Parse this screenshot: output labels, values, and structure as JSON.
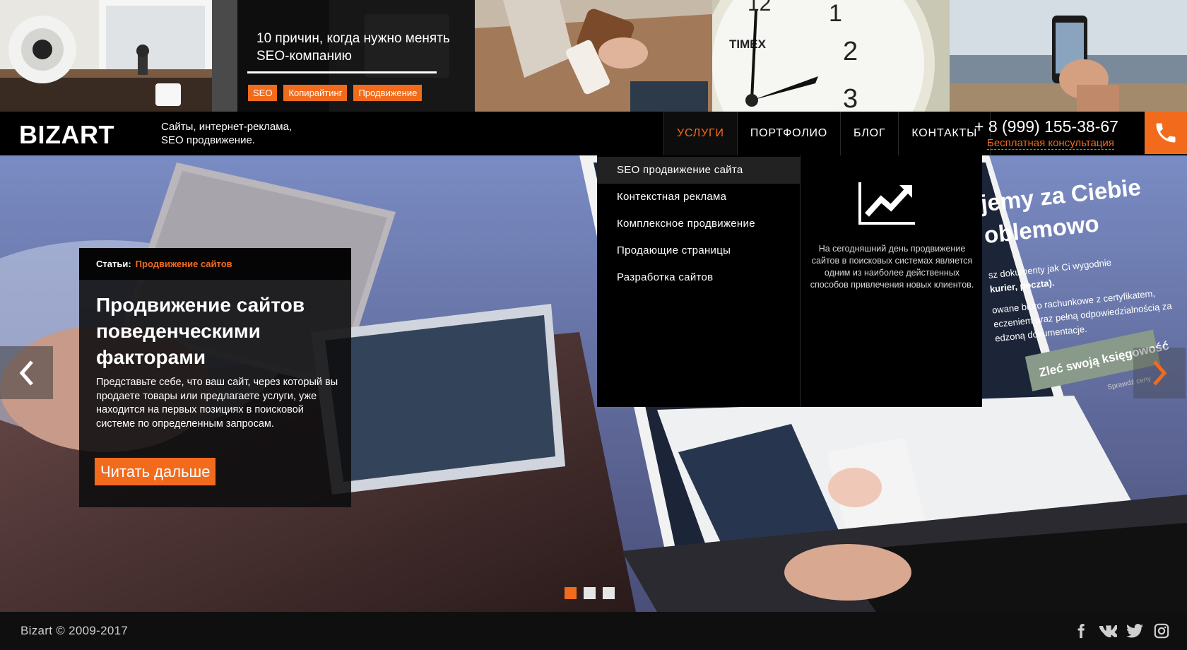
{
  "featured": {
    "title": "10 причин, когда нужно менять SEO-компанию",
    "tags": [
      "SEO",
      "Копирайтинг",
      "Продвижение"
    ]
  },
  "clock": {
    "brand": "TIMEX",
    "numbers": [
      "12",
      "1",
      "2",
      "3"
    ]
  },
  "header": {
    "logo": "BIZART",
    "tagline": "Сайты, интернет-реклама, SEO продвижение.",
    "nav": [
      "УСЛУГИ",
      "ПОРТФОЛИО",
      "БЛОГ",
      "КОНТАКТЫ"
    ],
    "phone": "+ 8 (999) 155-38-67",
    "consult": "Бесплатная консультация"
  },
  "dropdown": {
    "items": [
      "SEO продвижение сайта",
      "Контекстная реклама",
      "Комплексное продвижение",
      "Продающие страницы",
      "Разработка сайтов"
    ],
    "info": "На сегодняшний день продвижение сайтов в поисковых системах является одним из наиболее действенных способов привлечения новых клиентов."
  },
  "card": {
    "label": "Статьи:",
    "category": "Продвижение сайтов",
    "title": "Продвижение сайтов поведенческими факторами",
    "text": "Представьте себе, что ваш сайт, через который вы продаете товары или предлагаете услуги, уже находится на первых позициях в поисковой системе по определенным запросам.",
    "button": "Читать дальше"
  },
  "screen_text": {
    "line1": "jemy za Ciebie",
    "line2": "oblemowo",
    "line3": "sz dokumenty jak Ci wygodnie",
    "line4": "kurier, poczta).",
    "line5": "owane biuro rachunkowe z certyfikatem,",
    "line6": "eczeniem oraz pełną odpowiedzialnością za",
    "line7": "edzoną dokumentacje.",
    "button": "Zleć swoją księgowość",
    "small": "Sprawdź ceny"
  },
  "footer": {
    "copyright": "Bizart © 2009-2017"
  },
  "colors": {
    "accent": "#f26b1d"
  },
  "icons": [
    "phone-icon",
    "chart-up-icon",
    "chevron-left-icon",
    "chevron-right-icon",
    "facebook-icon",
    "vk-icon",
    "twitter-icon",
    "instagram-icon"
  ]
}
